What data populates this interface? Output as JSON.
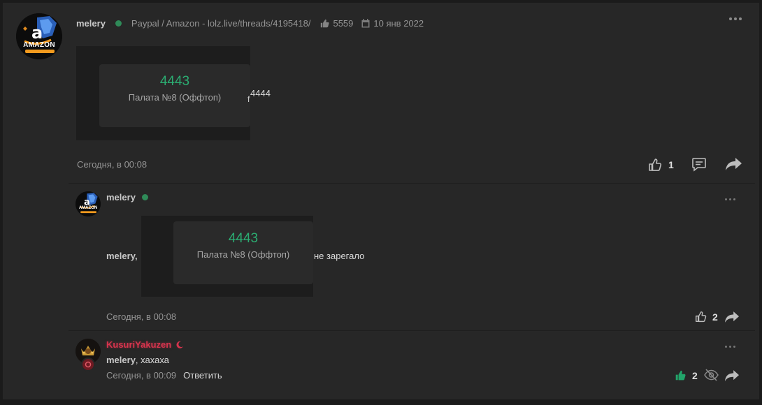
{
  "colors": {
    "page_bg": "#1b1b1b",
    "panel_bg": "#272727",
    "accent_green": "#2bad72",
    "online_green": "#2f8a58",
    "like_active": "#22a56a",
    "kusuri_name": "#d6344d"
  },
  "post": {
    "author": "melery",
    "thread_link": "Paypal / Amazon - lolz.live/threads/4195418/",
    "likes_total": "5559",
    "date": "10 янв 2022",
    "avatar_caption": "AMAZON",
    "embed_number": "4443",
    "embed_label": "Палата №8 (Оффтоп)",
    "trailing_text": "4444",
    "trailing_char": "f",
    "time": "Сегодня, в 00:08",
    "like_count": "1",
    "icons": [
      "thumb-up-icon",
      "comment-icon",
      "share-icon"
    ]
  },
  "comment1": {
    "author": "melery",
    "avatar_caption": "AMAZON",
    "mention": "melery,",
    "embed_number": "4443",
    "embed_label": "Палата №8 (Оффтоп)",
    "text": "не зарегало",
    "time": "Сегодня, в 00:08",
    "like_count": "2"
  },
  "comment2": {
    "author": "KusuriYakuzen",
    "mention": "melery",
    "text": ", хахаха",
    "time": "Сегодня, в 00:09",
    "reply_label": "Ответить",
    "like_count": "2"
  }
}
